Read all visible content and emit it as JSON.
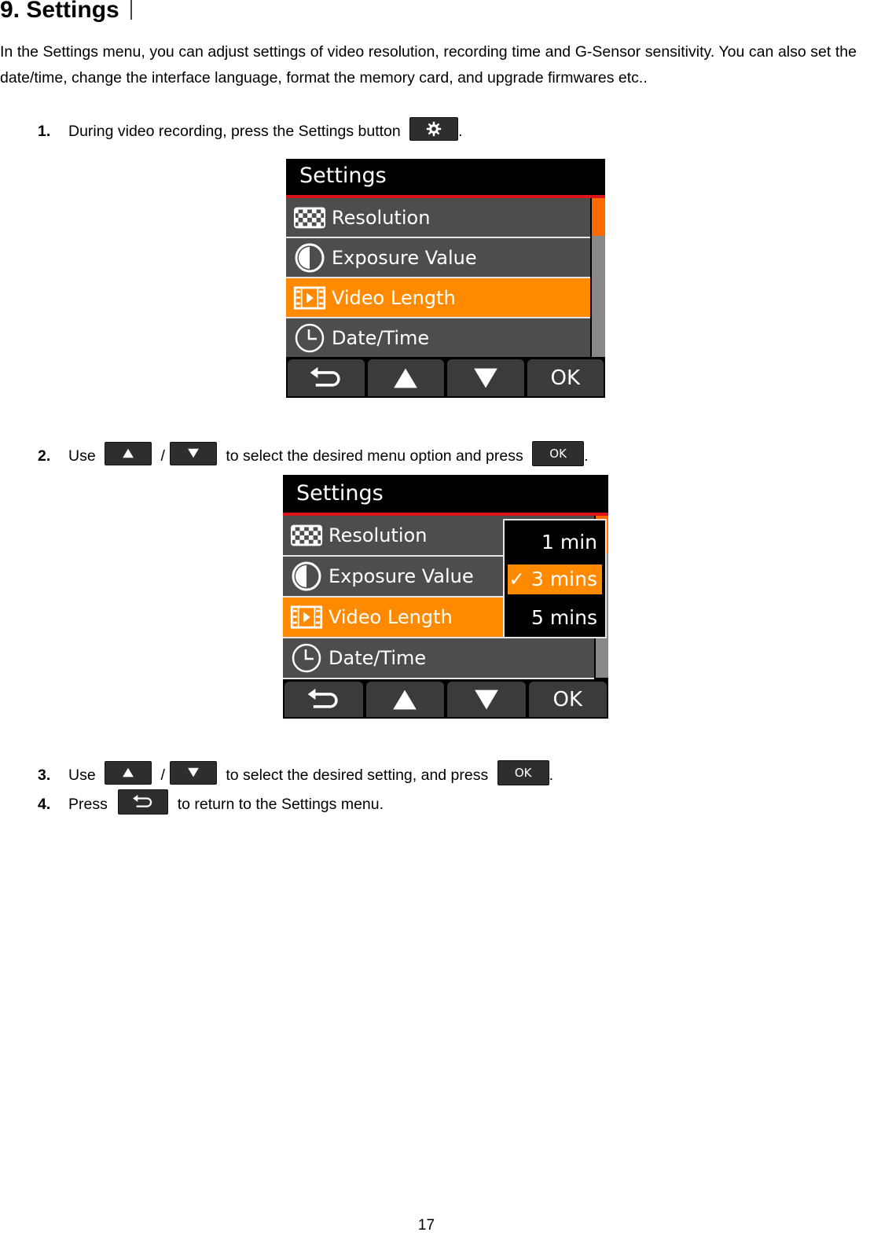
{
  "heading": {
    "number": "9.",
    "title": "Settings"
  },
  "intro": "In the Settings menu, you can adjust settings of video resolution, recording time and G-Sensor sensitivity. You can also set the date/time, change the interface language, format the memory card, and upgrade firmwares etc..",
  "steps": [
    {
      "num": "1.",
      "text_before": "During video recording, press the Settings button",
      "icon": "gear-icon",
      "text_after": "."
    },
    {
      "num": "2.",
      "text_use": "Use",
      "sep": "/",
      "text_before": "to select the desired menu option and press",
      "ok_label": "OK",
      "text_after": "."
    },
    {
      "num": "3.",
      "text_use": "Use",
      "sep": "/",
      "text_before": "to select the desired setting, and press",
      "ok_label": "OK",
      "text_after": "."
    },
    {
      "num": "4.",
      "text_use": "Press",
      "text_before": "to return to the Settings menu."
    }
  ],
  "screen1": {
    "title": "Settings",
    "items": [
      {
        "label": "Resolution",
        "icon": "resolution-grid-icon",
        "selected": false
      },
      {
        "label": "Exposure Value",
        "icon": "exposure-icon",
        "selected": false
      },
      {
        "label": "Video Length",
        "icon": "film-icon",
        "selected": true
      },
      {
        "label": "Date/Time",
        "icon": "clock-icon",
        "selected": false
      }
    ],
    "softkeys": [
      "back",
      "up",
      "down",
      "OK"
    ]
  },
  "screen2": {
    "title": "Settings",
    "items": [
      {
        "label": "Resolution",
        "icon": "resolution-grid-icon",
        "selected": false
      },
      {
        "label": "Exposure Value",
        "icon": "exposure-icon",
        "selected": false
      },
      {
        "label": "Video Length",
        "icon": "film-icon",
        "selected": true
      },
      {
        "label": "Date/Time",
        "icon": "clock-icon",
        "selected": false
      }
    ],
    "options": [
      {
        "label": "1 min",
        "selected": false
      },
      {
        "label": "✓ 3 mins",
        "selected": true
      },
      {
        "label": "5 mins",
        "selected": false
      }
    ],
    "softkeys": [
      "back",
      "up",
      "down",
      "OK"
    ]
  },
  "colors": {
    "highlight": "#ff8a00",
    "title_rule": "#d8141c",
    "row_bg": "#4d4d4d"
  },
  "page_number": "17"
}
